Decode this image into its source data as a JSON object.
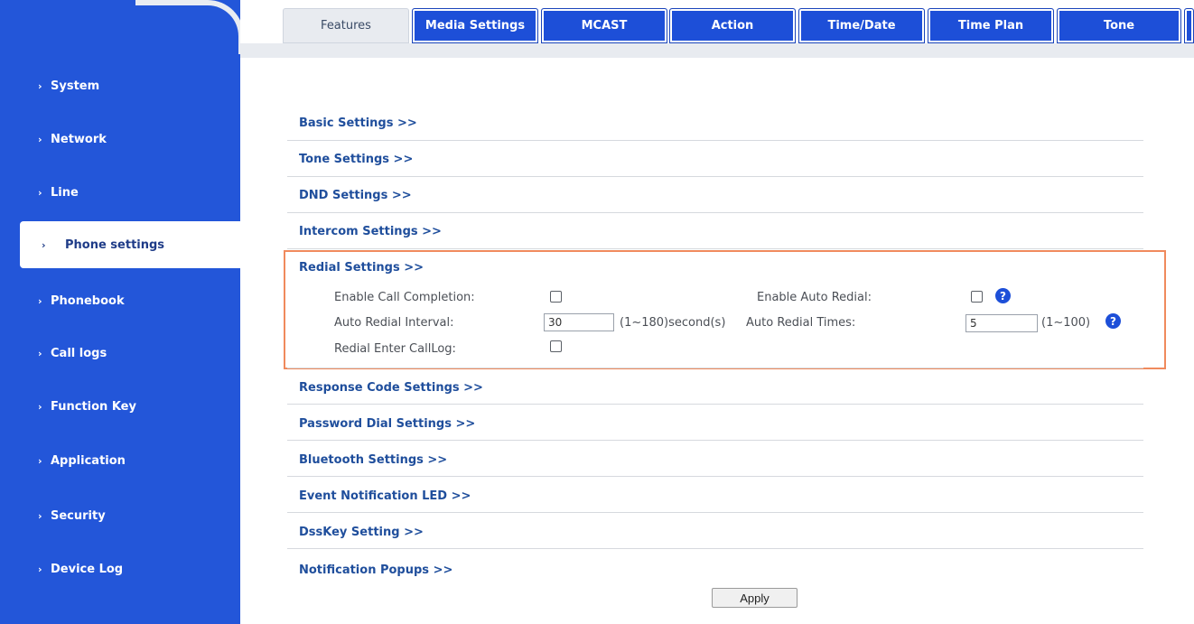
{
  "sidebar": {
    "items": [
      {
        "label": "System"
      },
      {
        "label": "Network"
      },
      {
        "label": "Line"
      },
      {
        "label": "Phone settings",
        "active": true
      },
      {
        "label": "Phonebook"
      },
      {
        "label": "Call logs"
      },
      {
        "label": "Function Key"
      },
      {
        "label": "Application"
      },
      {
        "label": "Security"
      },
      {
        "label": "Device Log"
      }
    ],
    "chevron": "›"
  },
  "tabs": [
    {
      "label": "Features",
      "active": true
    },
    {
      "label": "Media Settings"
    },
    {
      "label": "MCAST"
    },
    {
      "label": "Action"
    },
    {
      "label": "Time/Date"
    },
    {
      "label": "Time Plan"
    },
    {
      "label": "Tone"
    }
  ],
  "sections": {
    "basic": "Basic Settings >>",
    "tone": "Tone Settings >>",
    "dnd": "DND Settings >>",
    "intercom": "Intercom Settings >>",
    "redial": "Redial Settings >>",
    "response_code": "Response Code Settings >>",
    "password_dial": "Password Dial Settings >>",
    "bluetooth": "Bluetooth Settings >>",
    "event_led": "Event Notification LED >>",
    "dsskey": "DssKey Setting >>",
    "notification_popups": "Notification Popups >>"
  },
  "redial": {
    "enable_call_completion": {
      "label": "Enable Call Completion:",
      "checked": false
    },
    "enable_auto_redial": {
      "label": "Enable Auto Redial:",
      "checked": false
    },
    "auto_redial_interval": {
      "label": "Auto Redial Interval:",
      "value": "30",
      "range": "(1~180)second(s)"
    },
    "auto_redial_times": {
      "label": "Auto Redial Times:",
      "value": "5",
      "range": "(1~100)"
    },
    "redial_enter_calllog": {
      "label": "Redial Enter CallLog:",
      "checked": false
    }
  },
  "help_glyph": "?",
  "apply_label": "Apply",
  "colors": {
    "sidebar": "#2356d9",
    "tab": "#1d4fd8",
    "link": "#1f4e9c",
    "highlight": "#f08a5d"
  }
}
